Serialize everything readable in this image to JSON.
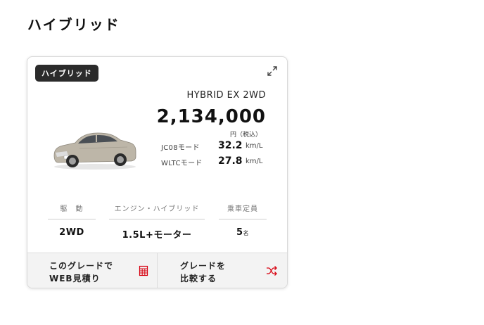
{
  "section": {
    "title": "ハイブリッド"
  },
  "card": {
    "badge": "ハイブリッド",
    "grade": "HYBRID EX 2WD",
    "price": "2,134,000",
    "price_unit": "円（税込）",
    "fuel": [
      {
        "mode": "JC08モード",
        "value": "32.2",
        "unit": "km/L"
      },
      {
        "mode": "WLTCモード",
        "value": "27.8",
        "unit": "km/L"
      }
    ],
    "specs": {
      "drive": {
        "label": "駆　動",
        "value": "2WD"
      },
      "engine": {
        "label": "エンジン・ハイブリッド",
        "value": "1.5L+モーター"
      },
      "capacity": {
        "label": "乗車定員",
        "value": "5",
        "unit": "名"
      }
    },
    "actions": {
      "estimate": "このグレードで\nWEB見積り",
      "compare": "グレードを\n比較する"
    },
    "accent_color": "#d7000f",
    "car_color": "silver"
  },
  "icons": {
    "expand": "expand-icon",
    "estimate": "calculator-icon",
    "compare": "shuffle-icon"
  }
}
